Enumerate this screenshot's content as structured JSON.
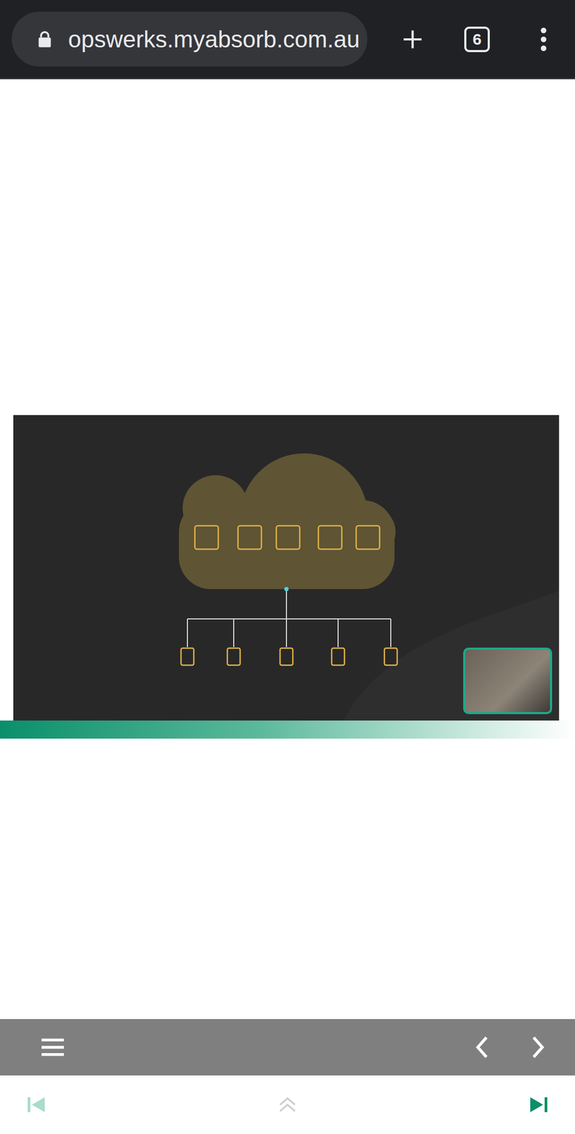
{
  "browser": {
    "url": "opswerks.myabsorb.com.au",
    "tab_count": "6"
  },
  "player_nav": {
    "previous": {
      "disabled": false
    },
    "next": {
      "disabled": false
    }
  },
  "bottom_nav": {
    "first": {
      "disabled": true
    },
    "up": {
      "disabled": true
    },
    "last": {
      "disabled": false
    }
  }
}
